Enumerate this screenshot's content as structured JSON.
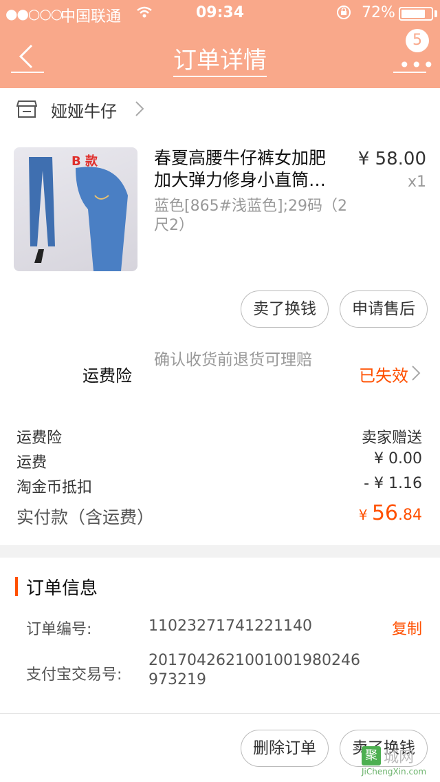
{
  "status_bar": {
    "signal": "●●○○○",
    "carrier": "中国联通",
    "time": "09:34",
    "battery": "72%"
  },
  "nav": {
    "title": "订单详情",
    "badge": "5"
  },
  "shop": {
    "name": "娅娅牛仔"
  },
  "product": {
    "image_label": "B 款",
    "title": "春夏高腰牛仔裤女加肥加大弹力修身小直筒…",
    "sku": "蓝色[865#浅蓝色];29码（2尺2）",
    "price": "¥ 58.00",
    "quantity": "x1"
  },
  "product_actions": {
    "sell": "卖了换钱",
    "after_sale": "申请售后"
  },
  "insurance": {
    "label": "运费险",
    "description": "确认收货前退货可理赔",
    "status": "已失效"
  },
  "fees": [
    {
      "label": "运费险",
      "value": "卖家赠送"
    },
    {
      "label": "运费",
      "value": "¥ 0.00"
    },
    {
      "label": "淘金币抵扣",
      "value": "- ¥ 1.16"
    }
  ],
  "total": {
    "label": "实付款（含运费）",
    "currency": "¥ ",
    "integer": "56",
    "decimal": ".84"
  },
  "order_info": {
    "title": "订单信息",
    "order_no_label": "订单编号:",
    "order_no": "11023271741221140",
    "copy": "复制",
    "alipay_label": "支付宝交易号:",
    "alipay_no": "2017042621001001980246973219"
  },
  "bottom_actions": {
    "delete": "删除订单",
    "sell": "卖了换钱"
  },
  "watermark": {
    "box": "聚",
    "text": "城网",
    "url": "JiChengXin.com"
  },
  "colors": {
    "header": "#f9a88a",
    "accent": "#ff5000"
  }
}
